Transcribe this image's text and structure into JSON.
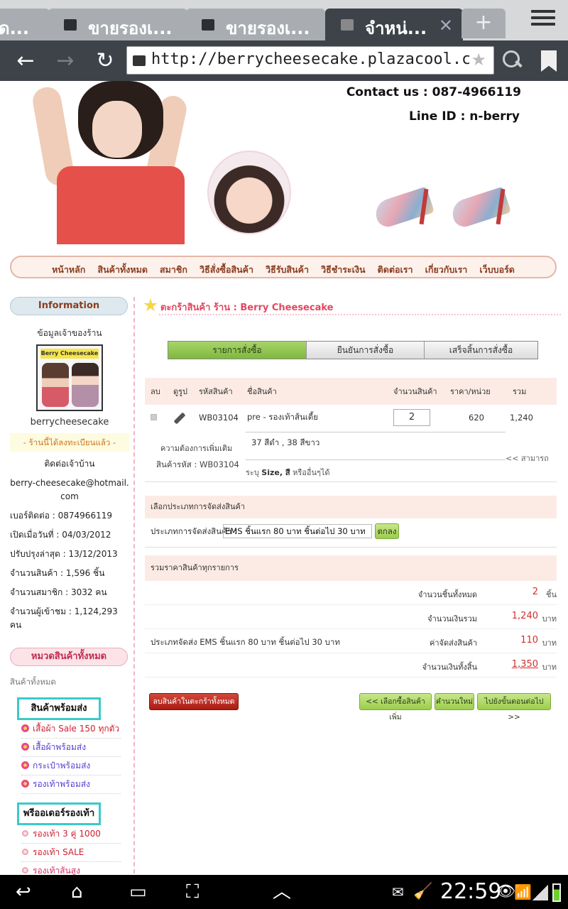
{
  "browser": {
    "tabs": [
      {
        "title": "ด..."
      },
      {
        "title": "ขายรองเ..."
      },
      {
        "title": "ขายรองเ..."
      },
      {
        "title": "จำหน่..."
      }
    ],
    "url": "http://berrycheesecake.plazacool.com/sho"
  },
  "header": {
    "contact": "Contact us : 087-4966119",
    "line_id": "Line ID : n-berry"
  },
  "nav": {
    "items": [
      "หน้าหลัก",
      "สินค้าทั้งหมด",
      "สมาชิก",
      "วิธีสั่งซื้อสินค้า",
      "วิธีรับสินค้า",
      "วิธีชำระเงิน",
      "ติดต่อเรา",
      "เกี่ยวกับเรา",
      "เว็บบอร์ด"
    ]
  },
  "sidebar": {
    "info_title": "Information",
    "owner_label": "ข้อมูลเจ้าของร้าน",
    "logo_text": "Berry Cheesecake",
    "shop_name": "berrycheesecake",
    "registered": "- ร้านนี้ได้ลงทะเบียนแล้ว -",
    "contact_label": "ติดต่อเจ้าบ้าน",
    "email": "berry-cheesecake@hotmail.com",
    "phone": "เบอร์ติดต่อ : 0874966119",
    "opened": "เปิดเมื่อวันที่ : 04/03/2012",
    "updated": "ปรับปรุงล่าสุด : 13/12/2013",
    "products": "จำนวนสินค้า : 1,596 ชิ้น",
    "members": "จำนวนสมาชิก : 3032 คน",
    "visitors": "จำนวนผู้เข้าชม : 1,124,293 คน",
    "categories_title": "หมวดสินค้าทั้งหมด",
    "all_products": "สินค้าทั้งหมด",
    "group1": "สินค้าพร้อมส่ง",
    "group1_items": [
      "เสื้อผ้า Sale 150 ทุกตัว",
      "เสื้อผ้าพร้อมส่ง",
      "กระเป๋าพร้อมส่ง",
      "รองเท้าพร้อมส่ง"
    ],
    "group2": "พรีออเดอร์รองเท้า",
    "group2_items": [
      "รองเท้า 3 คู่ 1000",
      "รองเท้า SALE",
      "รองเท้าส้นสูง"
    ]
  },
  "cart": {
    "title": "ตะกร้าสินค้า ร้าน : Berry Cheesecake",
    "steps": [
      "รายการสั่งซื้อ",
      "ยืนยันการสั่งซื้อ",
      "เสร็จสิ้นการสั่งซื้อ"
    ],
    "columns": [
      "ลบ",
      "ดูรูป",
      "รหัสสินค้า",
      "ชื่อสินค้า",
      "จำนวนสินค้า",
      "ราคา/หน่วย",
      "รวม"
    ],
    "item": {
      "code": "WB03104",
      "name": "pre - รองเท้าส้นเตี้ย",
      "qty": "2",
      "price": "620",
      "total": "1,240"
    },
    "extra_label": "ความต้องการเพิ่มเติม",
    "extra_code": "สินค้ารหัส : WB03104",
    "extra_value": "37 สีดำ , 38 สีขาว",
    "extra_more": "<< สามารถ",
    "extra_hint_prefix": "ระบุ ",
    "extra_hint_bold": "Size, สี",
    "extra_hint_suffix": " หรืออื่นๆได้",
    "shipping_head": "เลือกประเภทการจัดส่งสินค้า",
    "shipping_label": "ประเภทการจัดส่งสินค้า :",
    "shipping_value": "EMS ชิ้นแรก 80 บาท ชิ้นต่อไป 30 บาท",
    "ok_label": "ตกลง",
    "summary_head": "รวมราคาสินค้าทุกรายการ",
    "sum_qty_label": "จำนวนชิ้นทั้งหมด",
    "sum_qty": "2",
    "sum_qty_unit": "ชิ้น",
    "sum_amount_label": "จำนวนเงินรวม",
    "sum_amount": "1,240",
    "sum_ship_desc": "ประเภทจัดส่ง EMS ชิ้นแรก 80 บาท ชิ้นต่อไป 30 บาท",
    "sum_ship_label": "ค่าจัดส่งสินค้า",
    "sum_ship": "110",
    "sum_total_label": "จำนวนเงินทั้งสิ้น",
    "sum_total": "1,350",
    "unit_baht": "บาท",
    "btn_clear": "ลบสินค้าในตะกร้าทั้งหมด",
    "btn_continue": "<< เลือกซื้อสินค้าเพิ่ม",
    "btn_recalc": "คำนวนใหม่",
    "btn_next": "ไปยังขั้นตอนต่อไป >>"
  },
  "status": {
    "time": "22:59"
  },
  "colors": {
    "accent_green": "#9ccd4c",
    "header_pink": "#fcebe4",
    "price_red": "#d0302e",
    "chrome_dark": "#3d4349"
  }
}
